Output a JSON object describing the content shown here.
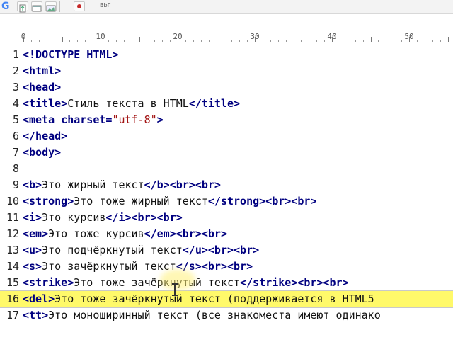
{
  "toolbar": {
    "items": [
      {
        "name": "google-logo",
        "glyph": "G"
      },
      {
        "name": "new-file-icon"
      },
      {
        "name": "window-icon"
      },
      {
        "name": "image-icon"
      },
      {
        "name": "record-icon"
      },
      {
        "name": "ab-button",
        "label": "BbГ"
      }
    ]
  },
  "ruler": {
    "labels": [
      "0",
      "10",
      "20",
      "30",
      "40",
      "50"
    ]
  },
  "editor": {
    "highlighted_line": 16,
    "lines": [
      {
        "n": "1",
        "tokens": [
          [
            "tag",
            "<!DOCTYPE HTML>"
          ]
        ]
      },
      {
        "n": "2",
        "tokens": [
          [
            "tag",
            "<html>"
          ]
        ]
      },
      {
        "n": "3",
        "tokens": [
          [
            "tag",
            "<head>"
          ]
        ]
      },
      {
        "n": "4",
        "tokens": [
          [
            "tag",
            "<title>"
          ],
          [
            "txt",
            "Стиль текста в HTML"
          ],
          [
            "tag",
            "</title>"
          ]
        ]
      },
      {
        "n": "5",
        "tokens": [
          [
            "tag",
            "<meta "
          ],
          [
            "attr",
            "charset="
          ],
          [
            "str",
            "\"utf-8\""
          ],
          [
            "tag",
            ">"
          ]
        ]
      },
      {
        "n": "6",
        "tokens": [
          [
            "tag",
            "</head>"
          ]
        ]
      },
      {
        "n": "7",
        "tokens": [
          [
            "tag",
            "<body>"
          ]
        ]
      },
      {
        "n": "8",
        "tokens": []
      },
      {
        "n": "9",
        "tokens": [
          [
            "tag",
            "<b>"
          ],
          [
            "txt",
            "Это жирный текст"
          ],
          [
            "tag",
            "</b><br><br>"
          ]
        ]
      },
      {
        "n": "10",
        "tokens": [
          [
            "tag",
            "<strong>"
          ],
          [
            "txt",
            "Это тоже жирный текст"
          ],
          [
            "tag",
            "</strong><br><br>"
          ]
        ]
      },
      {
        "n": "11",
        "tokens": [
          [
            "tag",
            "<i>"
          ],
          [
            "txt",
            "Это курсив"
          ],
          [
            "tag",
            "</i><br><br>"
          ]
        ]
      },
      {
        "n": "12",
        "tokens": [
          [
            "tag",
            "<em>"
          ],
          [
            "txt",
            "Это тоже курсив"
          ],
          [
            "tag",
            "</em><br><br>"
          ]
        ]
      },
      {
        "n": "13",
        "tokens": [
          [
            "tag",
            "<u>"
          ],
          [
            "txt",
            "Это подчёркнутый текст"
          ],
          [
            "tag",
            "</u><br><br>"
          ]
        ]
      },
      {
        "n": "14",
        "tokens": [
          [
            "tag",
            "<s>"
          ],
          [
            "txt",
            "Это зачёркнутый текст"
          ],
          [
            "tag",
            "</s><br><br>"
          ]
        ]
      },
      {
        "n": "15",
        "tokens": [
          [
            "tag",
            "<strike>"
          ],
          [
            "txt",
            "Это тоже зачёркнутый текст"
          ],
          [
            "tag",
            "</strike><br><br>"
          ]
        ]
      },
      {
        "n": "16",
        "tokens": [
          [
            "tag",
            "<del>"
          ],
          [
            "txt",
            "Это тоже зачёркнутый текст (поддерживается в HTML5"
          ]
        ]
      },
      {
        "n": "17",
        "tokens": [
          [
            "tag",
            "<tt>"
          ],
          [
            "txt",
            "Это моноширинный текст (все знакоместа имеют одинако"
          ]
        ]
      }
    ]
  }
}
